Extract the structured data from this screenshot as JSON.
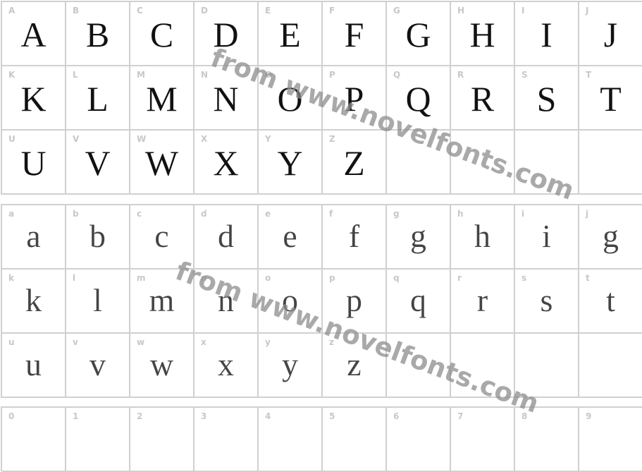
{
  "uppercase": [
    "A",
    "B",
    "C",
    "D",
    "E",
    "F",
    "G",
    "H",
    "I",
    "J",
    "K",
    "L",
    "M",
    "N",
    "O",
    "P",
    "Q",
    "R",
    "S",
    "T",
    "U",
    "V",
    "W",
    "X",
    "Y",
    "Z",
    "",
    "",
    " ",
    ""
  ],
  "lowercase": [
    "a",
    "b",
    "c",
    "d",
    "e",
    "f",
    "g",
    "h",
    "i",
    "j",
    "k",
    "l",
    "m",
    "n",
    "o",
    "p",
    "q",
    "r",
    "s",
    "t",
    "u",
    "v",
    "w",
    "x",
    "y",
    "z"
  ],
  "digits": [
    "0",
    "1",
    "2",
    "3",
    "4",
    "5",
    "6",
    "7",
    "8",
    "9"
  ],
  "uppercase_glyphs": [
    "A",
    "B",
    "C",
    "D",
    "E",
    "F",
    "G",
    "H",
    "I",
    "J",
    "K",
    "L",
    "M",
    "N",
    "O",
    "P",
    "Q",
    "R",
    "S",
    "T",
    "U",
    "V",
    "W",
    "X",
    "Y",
    "Z"
  ],
  "lowercase_glyphs": [
    "a",
    "b",
    "c",
    "d",
    "e",
    "f",
    "g",
    "h",
    "i",
    "g",
    "k",
    "l",
    "m",
    "n",
    "o",
    "p",
    "q",
    "r",
    "s",
    "t",
    "u",
    "v",
    "w",
    "x",
    "y",
    "z"
  ],
  "digit_glyphs": [
    "",
    "",
    "",
    "",
    "",
    "",
    "",
    "",
    "",
    ""
  ],
  "watermark": "from www.novelfonts.com",
  "colors": {
    "grid": "#d0d0d0",
    "label": "#c8c8c8",
    "glyph": "#111111",
    "watermark": "#8c8c8c"
  }
}
